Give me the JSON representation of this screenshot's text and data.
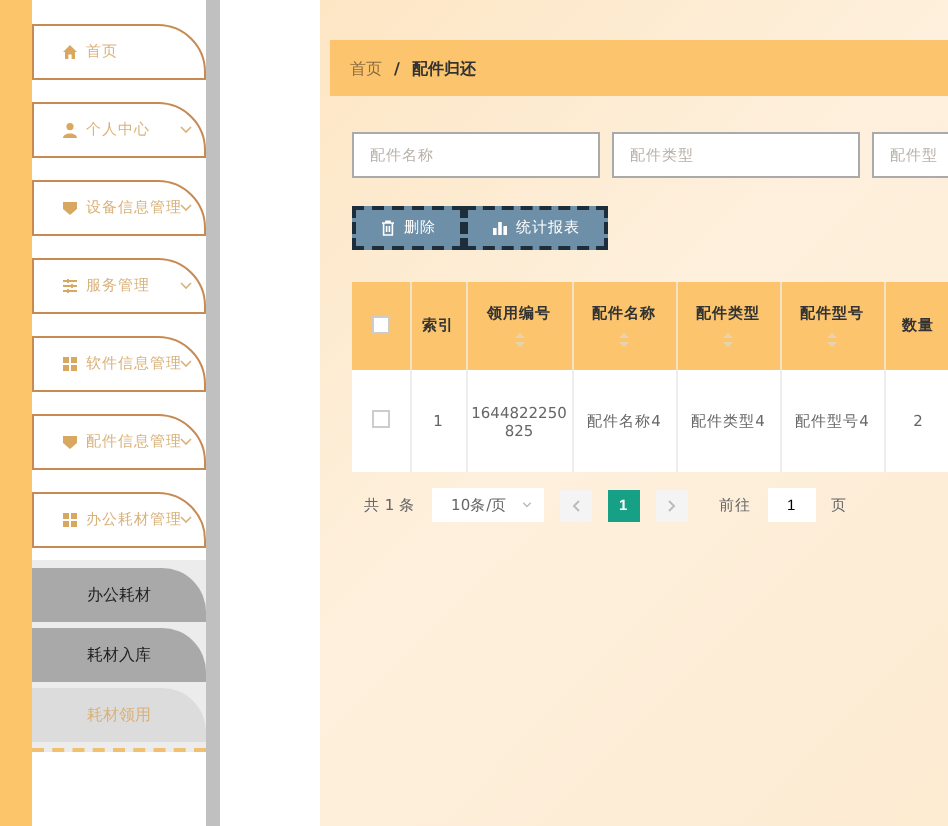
{
  "sidebar": {
    "items": [
      {
        "label": "首页",
        "kind": "link"
      },
      {
        "label": "个人中心",
        "kind": "group"
      },
      {
        "label": "设备信息管理",
        "kind": "group"
      },
      {
        "label": "服务管理",
        "kind": "group"
      },
      {
        "label": "软件信息管理",
        "kind": "group"
      },
      {
        "label": "配件信息管理",
        "kind": "group"
      },
      {
        "label": "办公耗材管理",
        "kind": "group",
        "children": [
          {
            "label": "办公耗材",
            "selected": false
          },
          {
            "label": "耗材入库",
            "selected": false
          },
          {
            "label": "耗材领用",
            "selected": true
          }
        ]
      }
    ]
  },
  "breadcrumb": [
    {
      "label": "首页"
    },
    {
      "label": "/"
    },
    {
      "label": "配件归还"
    }
  ],
  "search": [
    {
      "placeholder": "配件名称"
    },
    {
      "placeholder": "配件类型"
    },
    {
      "placeholder": "配件型"
    }
  ],
  "buttons": [
    {
      "label": "删除"
    },
    {
      "label": "统计报表"
    }
  ],
  "table": {
    "header_checked": false,
    "columns": [
      {
        "label": "索引",
        "kind": "plain"
      },
      {
        "label": "领用编号",
        "kind": "sortable"
      },
      {
        "label": "配件名称",
        "kind": "sortable"
      },
      {
        "label": "配件类型",
        "kind": "sortable"
      },
      {
        "label": "配件型号",
        "kind": "sortable"
      },
      {
        "label": "数量",
        "kind": "plain"
      }
    ],
    "rows": [
      {
        "checked": false,
        "cells": [
          "1",
          "1644822250825",
          "配件名称4",
          "配件类型4",
          "配件型号4",
          "2"
        ]
      }
    ]
  },
  "pagination": {
    "total": "共 1 条",
    "page_size": "10条/页",
    "pages": [
      {
        "label": "1",
        "selected": true
      }
    ],
    "goto_label": "前往",
    "goto_value": "1",
    "page_suffix": "页"
  }
}
